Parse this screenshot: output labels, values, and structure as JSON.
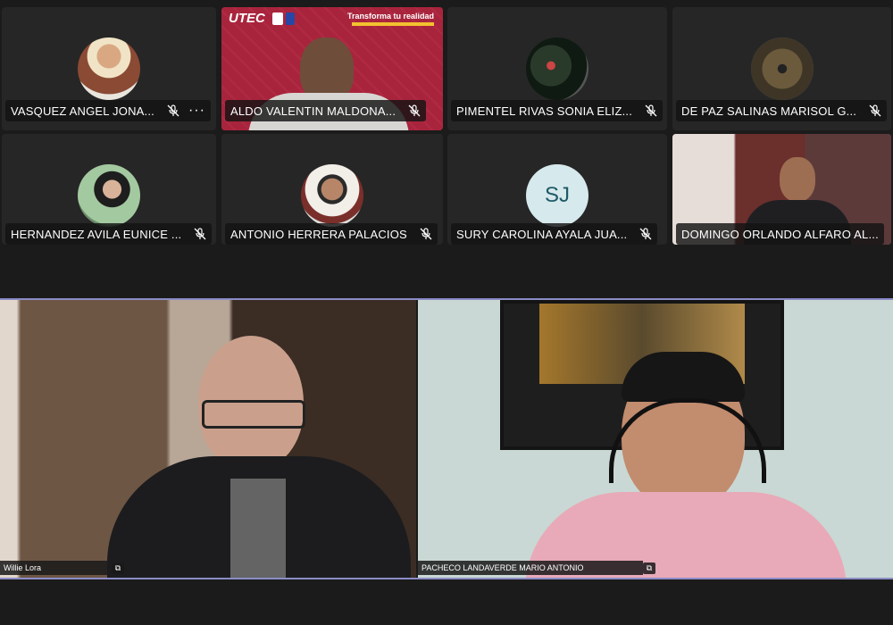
{
  "grid": [
    {
      "name": "VASQUEZ ANGEL JONA...",
      "more": "···"
    },
    {
      "name": "ALDO VALENTIN MALDONA...",
      "banner_logo": "UTEC",
      "banner_text": "Transforma tu realidad"
    },
    {
      "name": "PIMENTEL RIVAS SONIA ELIZ..."
    },
    {
      "name": "DE PAZ SALINAS MARISOL G..."
    },
    {
      "name": "HERNANDEZ AVILA EUNICE ..."
    },
    {
      "name": "ANTONIO HERRERA PALACIOS"
    },
    {
      "name": "SURY CAROLINA AYALA JUA...",
      "initials": "SJ"
    },
    {
      "name": "DOMINGO ORLANDO ALFARO AL..."
    }
  ],
  "spotlight": [
    {
      "name": "Willie Lora"
    },
    {
      "name": "PACHECO LANDAVERDE MARIO ANTONIO"
    }
  ],
  "colors": {
    "active_border": "#8b8cc7",
    "tile_bg": "#262626",
    "initials_bg": "#d6e9ec",
    "initials_fg": "#1e5a66"
  }
}
